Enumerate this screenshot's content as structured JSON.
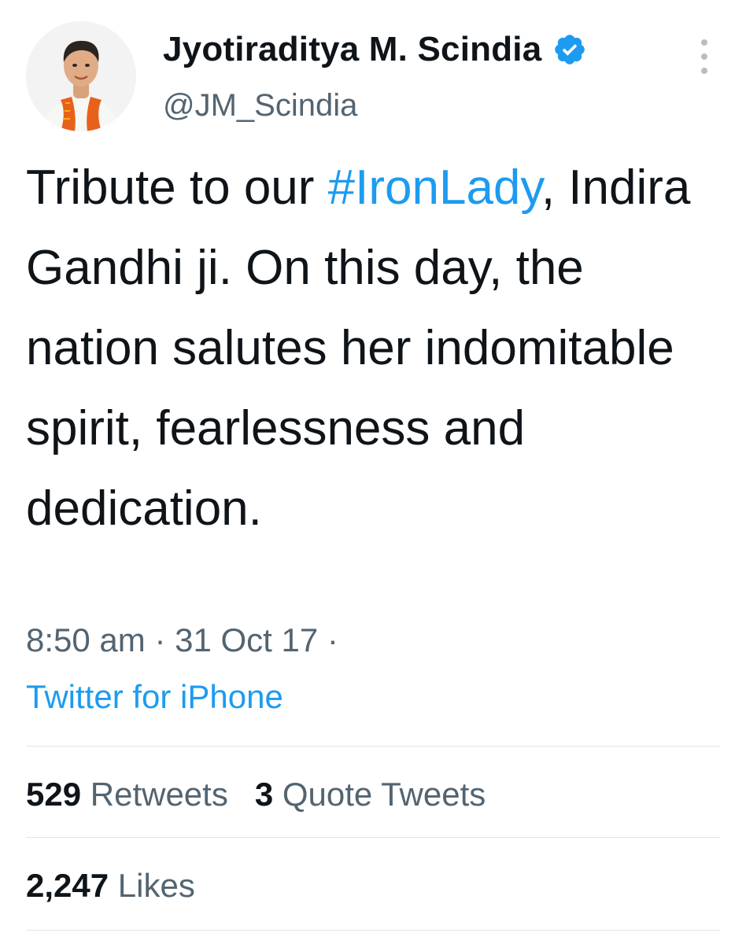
{
  "author": {
    "display_name": "Jyotiraditya M. Scindia",
    "handle": "@JM_Scindia",
    "verified_icon": "verified-badge-icon",
    "avatar": "profile-photo",
    "verified_color": "#1d9bf0"
  },
  "tweet": {
    "text_before": "Tribute to our ",
    "hashtag": "#IronLady",
    "text_after": ", Indira Gandhi ji. On this day, the nation salutes her indomitable spirit, fearlessness and dedication.",
    "time": "8:50 am",
    "separator": "·",
    "date": "31 Oct 17",
    "source": "Twitter for iPhone"
  },
  "stats": {
    "retweets_count": "529",
    "retweets_label": "Retweets",
    "quotes_count": "3",
    "quotes_label": "Quote Tweets",
    "likes_count": "2,247",
    "likes_label": "Likes"
  },
  "colors": {
    "link": "#1d9bf0",
    "secondary_text": "#536471",
    "primary_text": "#0f1419",
    "divider": "#e3e6e8"
  }
}
